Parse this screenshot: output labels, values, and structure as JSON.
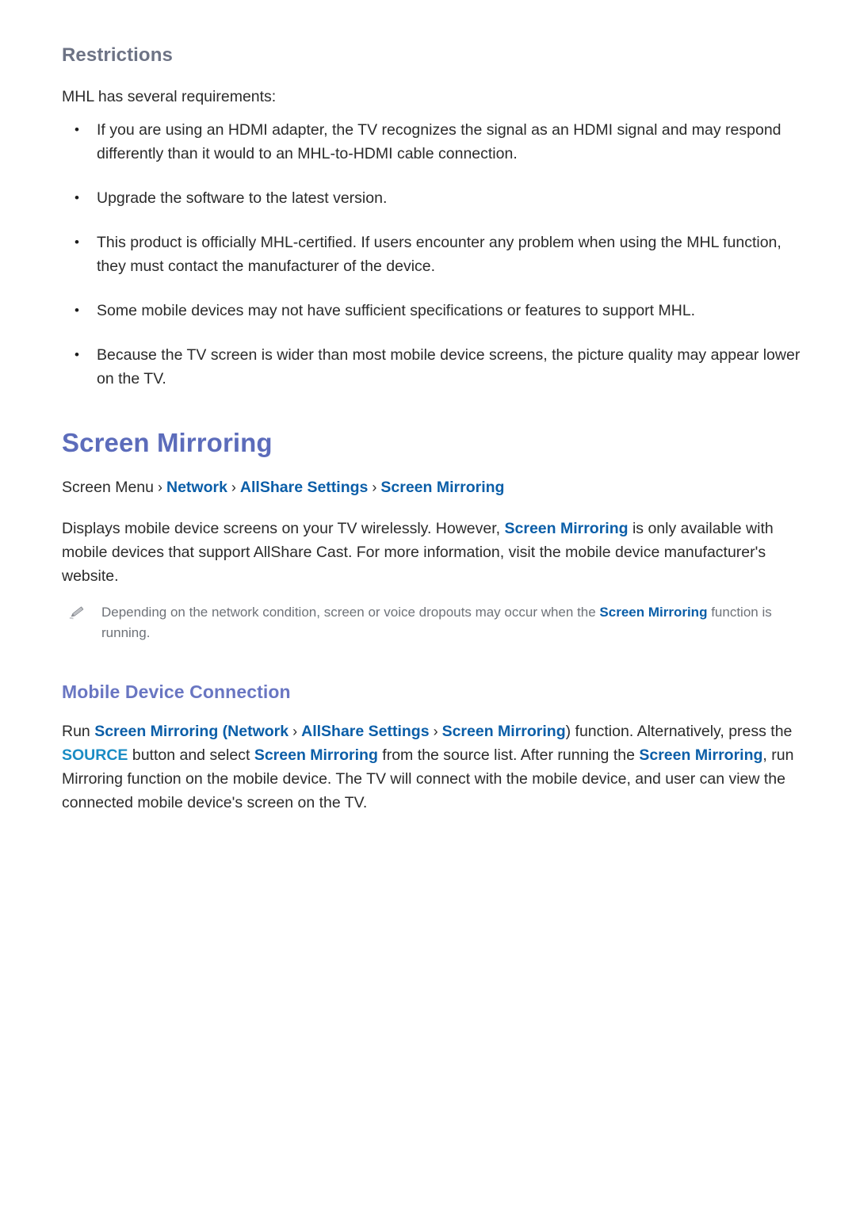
{
  "document": {
    "restrictions": {
      "heading": "Restrictions",
      "intro": "MHL has several requirements:",
      "bullets": [
        "If you are using an HDMI adapter, the TV recognizes the signal as an HDMI signal and may respond differently than it would to an MHL-to-HDMI cable connection.",
        "Upgrade the software to the latest version.",
        "This product is officially MHL-certified. If users encounter any problem when using the MHL function, they must contact the manufacturer of the device.",
        "Some mobile devices may not have sufficient specifications or features to support MHL.",
        "Because the TV screen is wider than most mobile device screens, the picture quality may appear lower on the TV."
      ]
    },
    "screen_mirroring": {
      "heading": "Screen Mirroring",
      "breadcrumb": {
        "root": "Screen Menu",
        "separator": "›",
        "items": [
          "Network",
          "AllShare Settings",
          "Screen Mirroring"
        ]
      },
      "body": {
        "part1": "Displays mobile device screens on your TV wirelessly. However, ",
        "link1": "Screen Mirroring",
        "part2": " is only available with mobile devices that support AllShare Cast. For more information, visit the mobile device manufacturer's website."
      },
      "note": {
        "icon": "pencil-icon",
        "part1": "Depending on the network condition, screen or voice dropouts may occur when the ",
        "link1": "Screen Mirroring",
        "part2": " function is running."
      }
    },
    "mobile_device_connection": {
      "heading": "Mobile Device Connection",
      "body": {
        "t1": "Run ",
        "l1": "Screen Mirroring",
        "t2": " (",
        "l2": "Network",
        "sep1": "›",
        "l3": "AllShare Settings",
        "sep2": "›",
        "l4": "Screen Mirroring",
        "t3": ") function. Alternatively, press the ",
        "l5": "SOURCE",
        "t4": " button and select ",
        "l6": "Screen Mirroring",
        "t5": " from the source list. After running the ",
        "l7": "Screen Mirroring",
        "t6": ", run Mirroring function on the mobile device. The TV will connect with the mobile device, and user can view the connected mobile device's screen on the TV."
      }
    }
  },
  "colors": {
    "sub_heading": "#6d7385",
    "main_heading": "#5c6cbb",
    "section_heading": "#6976c2",
    "link_blue": "#0b5ea8",
    "source_blue": "#1a8cc4",
    "body_text": "#2b2b2b",
    "note_text": "#6e7278",
    "background": "#ffffff"
  }
}
